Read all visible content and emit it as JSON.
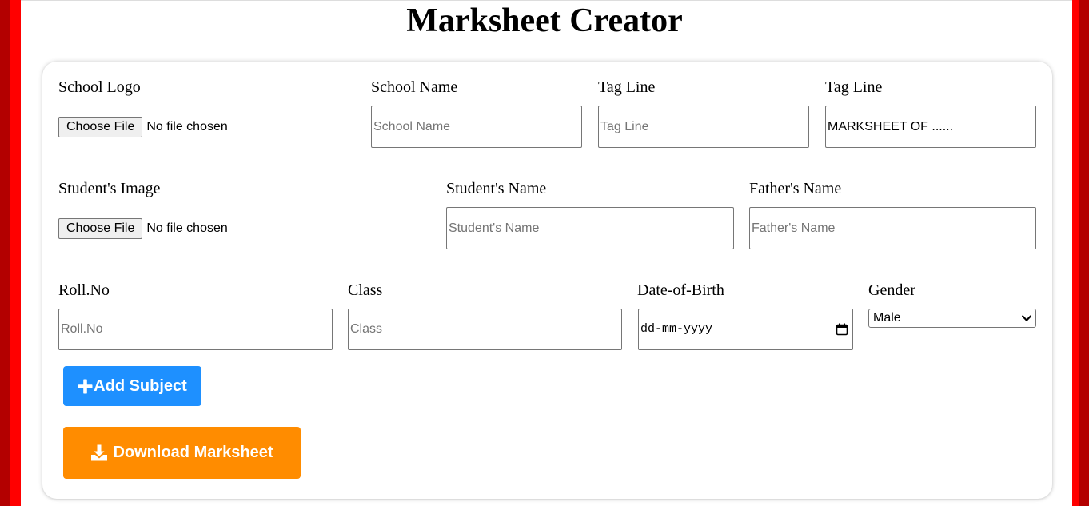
{
  "page": {
    "title": "Marksheet Creator"
  },
  "form": {
    "school_logo": {
      "label": "School Logo",
      "button": "Choose File",
      "status": "No file chosen"
    },
    "school_name": {
      "label": "School Name",
      "placeholder": "School Name",
      "value": ""
    },
    "tag_line_1": {
      "label": "Tag Line",
      "placeholder": "Tag Line",
      "value": ""
    },
    "tag_line_2": {
      "label": "Tag Line",
      "placeholder": "",
      "value": "MARKSHEET OF ......"
    },
    "student_image": {
      "label": "Student's Image",
      "button": "Choose File",
      "status": "No file chosen"
    },
    "student_name": {
      "label": "Student's Name",
      "placeholder": "Student's Name",
      "value": ""
    },
    "father_name": {
      "label": "Father's Name",
      "placeholder": "Father's Name",
      "value": ""
    },
    "roll_no": {
      "label": "Roll.No",
      "placeholder": "Roll.No",
      "value": ""
    },
    "class": {
      "label": "Class",
      "placeholder": "Class",
      "value": ""
    },
    "dob": {
      "label": "Date-of-Birth",
      "display": "dd-mm-yyyy"
    },
    "gender": {
      "label": "Gender",
      "selected": "Male"
    }
  },
  "actions": {
    "add_subject": "Add Subject",
    "download": "Download Marksheet"
  },
  "icons": {
    "add": "plus-icon",
    "download": "download-icon",
    "calendar": "calendar-icon",
    "dropdown": "chevron-down-icon"
  },
  "colors": {
    "accent_red": "#ff0000",
    "dark_red": "#b30000",
    "add_button": "#1e90ff",
    "download_button": "#ff8c00"
  }
}
